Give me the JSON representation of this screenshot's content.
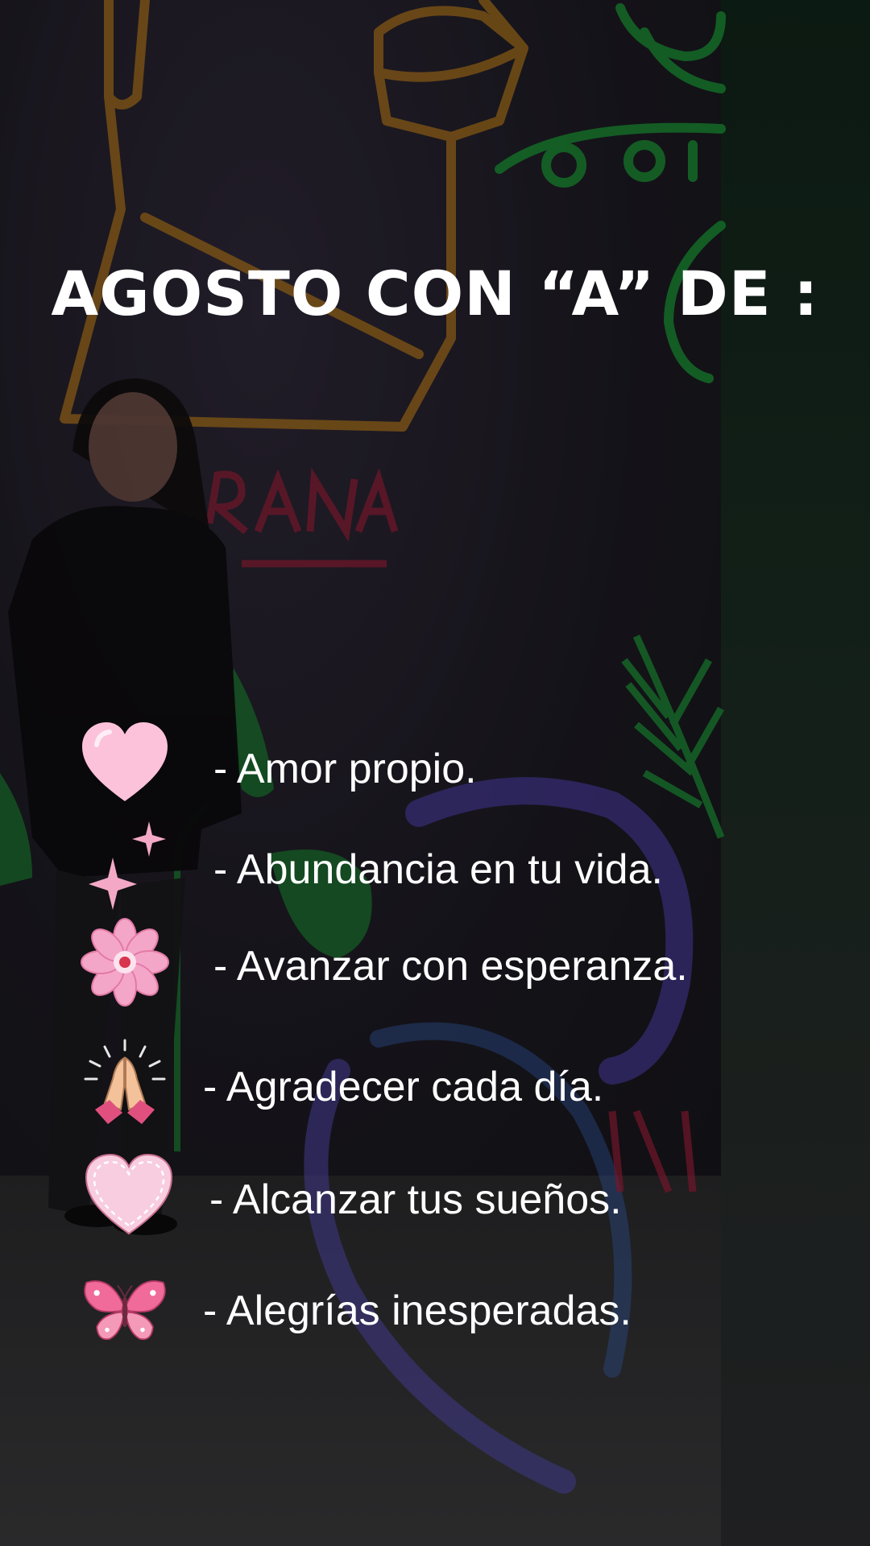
{
  "title": "AGOSTO CON “A” DE :",
  "items": [
    {
      "icon": "pink-heart-icon",
      "text": "- Amor propio."
    },
    {
      "icon": "sparkles-icon",
      "text": "- Abundancia en tu vida."
    },
    {
      "icon": "pink-flower-icon",
      "text": "- Avanzar con esperanza."
    },
    {
      "icon": "praying-hands-icon",
      "text": "- Agradecer cada día."
    },
    {
      "icon": "stitched-heart-icon",
      "text": "- Alcanzar tus sueños."
    },
    {
      "icon": "butterfly-icon",
      "text": "- Alegrías inesperadas."
    }
  ],
  "colors": {
    "text": "#ffffff",
    "pink": "#f7b6d2",
    "deep_pink": "#e0507e",
    "neon_orange": "#d18a1e",
    "neon_green": "#1fa33c"
  }
}
